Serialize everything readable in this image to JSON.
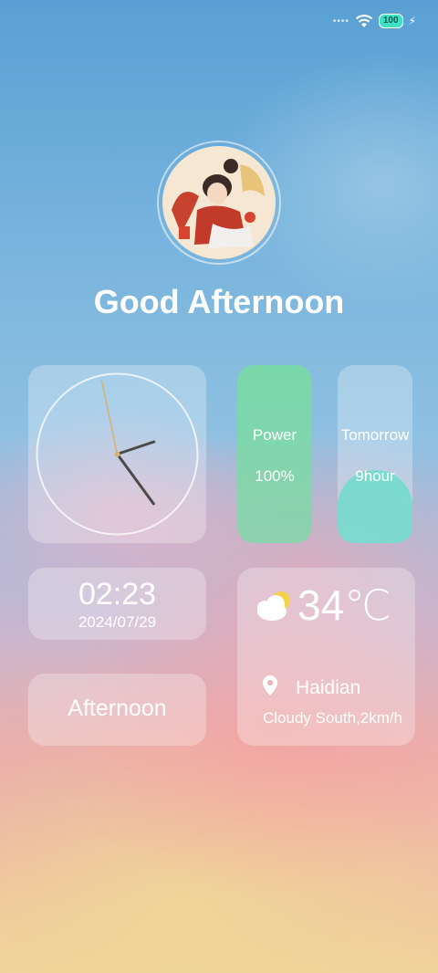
{
  "status_bar": {
    "battery_level": "100",
    "icons": [
      "signal-dots-icon",
      "wifi-icon",
      "battery-icon",
      "charging-bolt-icon"
    ]
  },
  "greeting": "Good Afternoon",
  "clock": {
    "hour": 2,
    "minute": 23,
    "second": 58
  },
  "power": {
    "label": "Power",
    "value": "100%"
  },
  "tomorrow": {
    "label": "Tomorrow",
    "value": "9hour"
  },
  "datetime": {
    "time": "02:23",
    "date": "2024/07/29"
  },
  "period": "Afternoon",
  "weather": {
    "temperature": "34℃",
    "location": "Haidian",
    "description": "Cloudy South,2km/h",
    "icon": "partly-cloudy-icon"
  },
  "colors": {
    "power_fill": "#7adba0",
    "tomorrow_fill": "#6edccd",
    "battery": "#3ee0c6"
  }
}
